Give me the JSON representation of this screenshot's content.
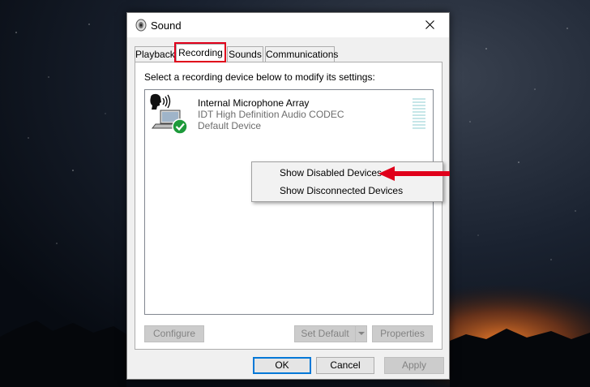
{
  "window": {
    "title": "Sound",
    "tabs": [
      {
        "label": "Playback",
        "active": false
      },
      {
        "label": "Recording",
        "active": true
      },
      {
        "label": "Sounds",
        "active": false
      },
      {
        "label": "Communications",
        "active": false
      }
    ]
  },
  "recording": {
    "instruction": "Select a recording device below to modify its settings:",
    "device": {
      "name": "Internal Microphone Array",
      "driver": "IDT High Definition Audio CODEC",
      "status": "Default Device"
    },
    "buttons": {
      "configure": "Configure",
      "set_default": "Set Default",
      "properties": "Properties"
    }
  },
  "context_menu": {
    "items": [
      "Show Disabled Devices",
      "Show Disconnected Devices"
    ]
  },
  "footer": {
    "ok": "OK",
    "cancel": "Cancel",
    "apply": "Apply"
  },
  "colors": {
    "highlight": "#e0001b",
    "accent": "#0078d7",
    "check": "#1d9a3a"
  }
}
